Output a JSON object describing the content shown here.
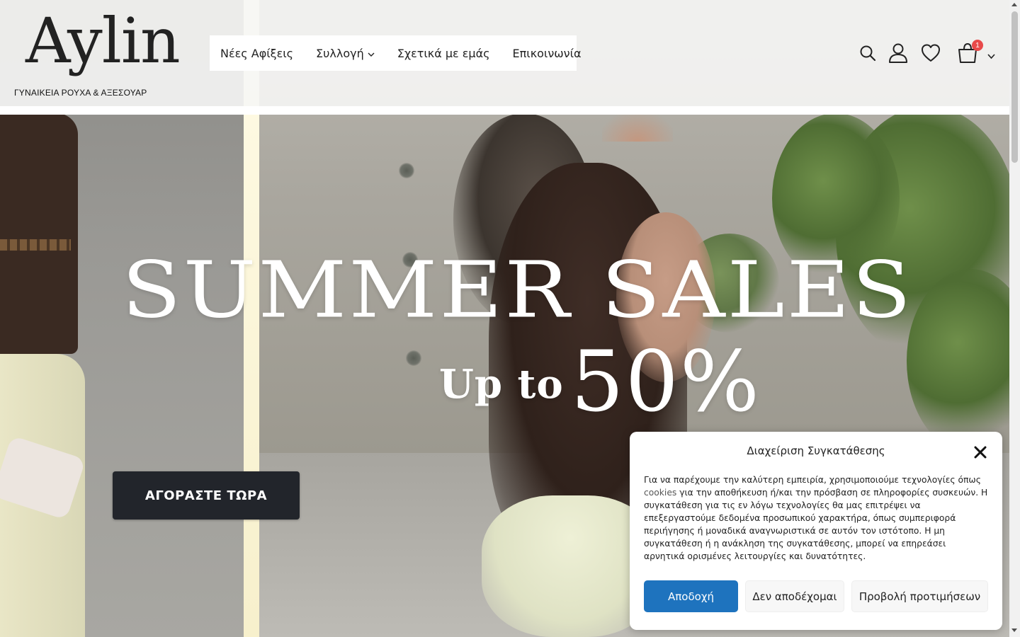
{
  "brand": {
    "logo": "Aylin",
    "tagline": "ΓΥΝΑΙΚΕΙΑ ΡΟΥΧΑ & ΑΞΕΣΟΥΑΡ"
  },
  "nav": {
    "items": [
      {
        "label": "Νέες Αφίξεις",
        "has_dropdown": false
      },
      {
        "label": "Συλλογή",
        "has_dropdown": true
      },
      {
        "label": "Σχετικά με εμάς",
        "has_dropdown": false
      },
      {
        "label": "Επικοινωνία",
        "has_dropdown": false
      }
    ]
  },
  "header_icons": {
    "search": "search-icon",
    "account": "user-icon",
    "wishlist": "heart-icon",
    "cart": "cart-icon",
    "cart_count": "1",
    "cart_badge_color": "#e84a4a"
  },
  "hero": {
    "headline": "SUMMER SALES",
    "subline_prefix": "Up to",
    "subline_value": "50%",
    "cta_label": "ΑΓΟΡΑΣΤΕ ΤΩΡΑ",
    "cta_color": "#22252b"
  },
  "consent": {
    "title": "Διαχείριση Συγκατάθεσης",
    "text_before": "Για να παρέχουμε την καλύτερη εμπειρία, χρησιμοποιούμε τεχνολογίες όπως ",
    "text_link": "cookies",
    "text_after": " για την αποθήκευση ή/και την πρόσβαση σε πληροφορίες συσκευών. Η συγκατάθεση για τις εν λόγω τεχνολογίες θα μας επιτρέψει να επεξεργαστούμε δεδομένα προσωπικού χαρακτήρα, όπως συμπεριφορά περιήγησης ή μοναδικά αναγνωριστικά σε αυτόν τον ιστότοπο. Η μη συγκατάθεση ή η ανάκληση της συγκατάθεσης, μπορεί να επηρεάσει αρνητικά ορισμένες λειτουργίες και δυνατότητες.",
    "accept_label": "Αποδοχή",
    "deny_label": "Δεν αποδέχομαι",
    "prefs_label": "Προβολή προτιμήσεων",
    "accept_color": "#1e73be",
    "close_icon": "close-icon"
  }
}
